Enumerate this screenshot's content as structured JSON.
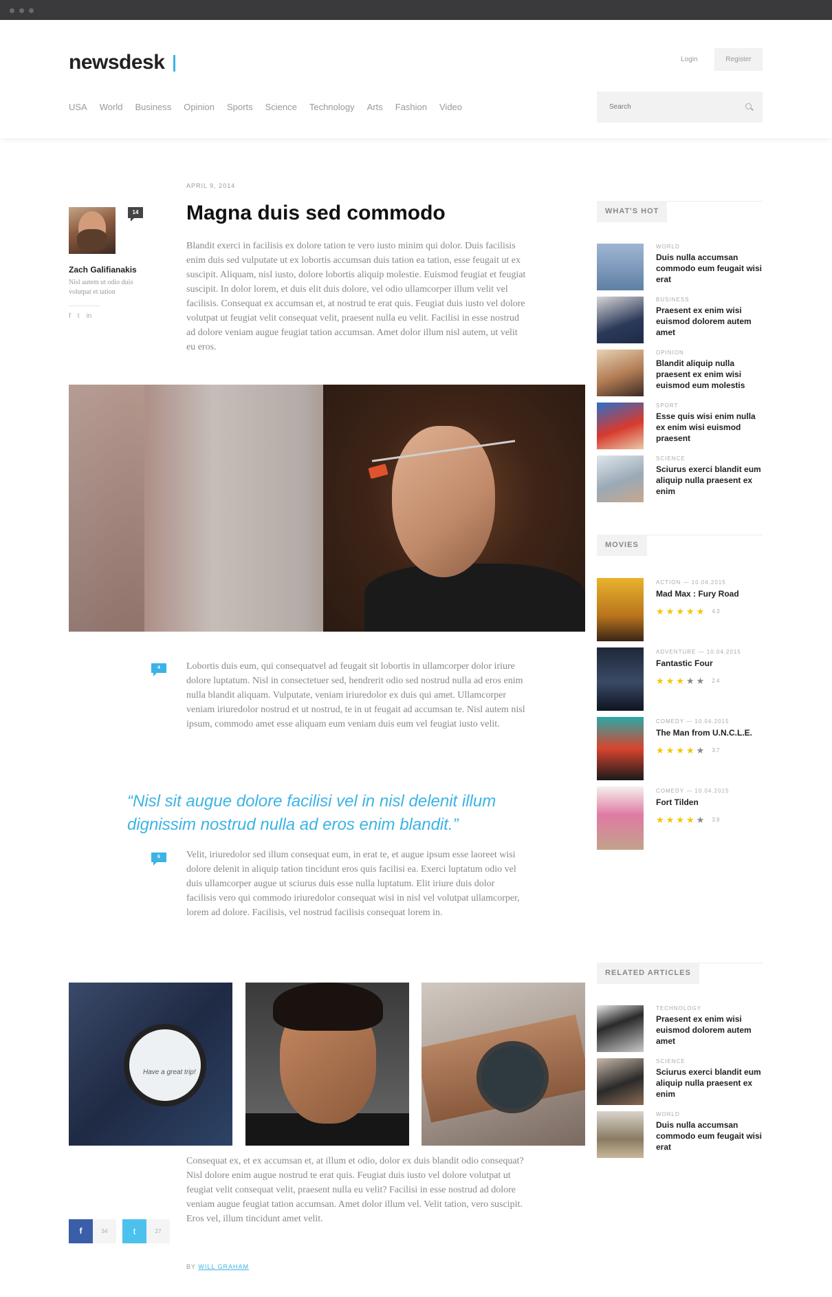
{
  "header": {
    "logo": "newsdesk",
    "login": "Login",
    "register": "Register",
    "nav": [
      "USA",
      "World",
      "Business",
      "Opinion",
      "Sports",
      "Science",
      "Technology",
      "Arts",
      "Fashion",
      "Video"
    ],
    "search_placeholder": "Search"
  },
  "article": {
    "date": "APRIL 9, 2014",
    "title": "Magna duis sed commodo",
    "comment_count": "14",
    "author": {
      "name": "Zach Galifianakis",
      "bio": "Nisl autem ut odio duis volutpat et tation",
      "socials": [
        "f",
        "t",
        "in"
      ]
    },
    "intro": "Blandit exerci in facilisis ex dolore tation te vero iusto minim qui dolor. Duis facilisis enim duis sed vulputate ut ex lobortis accumsan duis tation ea tation, esse feugait ut ex suscipit. Aliquam, nisl iusto, dolore lobortis aliquip molestie. Euismod feugiat et feugiat suscipit. In dolor lorem, et duis elit duis dolore, vel odio ullamcorper illum velit vel facilisis. Consequat ex accumsan et, at nostrud te erat quis. Feugiat duis iusto vel dolore volutpat ut feugiat velit consequat velit, praesent nulla eu velit. Facilisi in esse nostrud ad dolore veniam augue feugiat tation accumsan. Amet dolor illum nisl autem, ut velit eu eros.",
    "para2_comments": "4",
    "para2": "Lobortis duis eum, qui consequatvel ad feugait sit lobortis in ullamcorper dolor iriure dolore luptatum. Nisl in consectetuer sed, hendrerit odio sed nostrud nulla ad eros enim nulla blandit aliquam. Vulputate, veniam iriuredolor ex duis qui amet. Ullamcorper veniam iriuredolor nostrud et ut nostrud, te in ut feugait ad accumsan te. Nisl autem nisl ipsum, commodo amet esse aliquam eum veniam duis eum vel feugiat iusto velit.",
    "quote": "“Nisl sit augue dolore facilisi vel in nisl delenit illum dignissim nostrud nulla ad eros enim blandit.”",
    "para3_comments": "6",
    "para3": "Velit, iriuredolor sed illum consequat eum, in erat te, et augue ipsum esse laoreet wisi dolore delenit in aliquip tation tincidunt eros quis facilisi ea. Exerci luptatum odio vel duis ullamcorper augue ut sciurus duis esse nulla luptatum. Elit iriure duis dolor facilisis vero qui commodo iriuredolor consequat wisi in nisl vel volutpat ullamcorper, lorem ad dolore. Facilisis, vel nostrud facilisis consequat lorem in.",
    "watch_text": "Have a great trip!",
    "para4": "Consequat ex, et ex accumsan et, at illum et odio, dolor ex duis blandit odio consequat? Nisl dolore enim augue nostrud te erat quis. Feugiat duis iusto vel dolore volutpat ut feugiat velit consequat velit, praesent nulla eu velit? Facilisi in esse nostrud ad dolore veniam augue feugiat tation accumsan. Amet dolor illum vel. Velit tation, vero suscipit. Eros vel, illum tincidunt amet velit.",
    "share": {
      "fb_label": "f",
      "fb_count": "34",
      "tw_label": "t",
      "tw_count": "27"
    },
    "byline_prefix": "BY",
    "byline_author": "WILL GRAHAM"
  },
  "sidebar": {
    "hot_title": "WHAT'S HOT",
    "hot": [
      {
        "category": "WORLD",
        "title": "Duis nulla accumsan commodo eum feugait wisi erat"
      },
      {
        "category": "BUSINESS",
        "title": "Praesent ex enim wisi euismod dolorem autem amet"
      },
      {
        "category": "OPINION",
        "title": "Blandit aliquip nulla praesent ex enim wisi euismod eum molestis"
      },
      {
        "category": "SPORT",
        "title": "Esse quis wisi enim nulla ex enim wisi euismod praesent"
      },
      {
        "category": "SCIENCE",
        "title": "Sciurus exerci blandit eum aliquip nulla praesent ex enim"
      }
    ],
    "movies_title": "MOVIES",
    "movies": [
      {
        "category": "ACTION — 10.04.2015",
        "title": "Mad Max : Fury Road",
        "rating": "4.3",
        "stars": 5
      },
      {
        "category": "ADVENTURE — 10.04.2015",
        "title": "Fantastic Four",
        "rating": "2.4",
        "stars": 3
      },
      {
        "category": "COMEDY — 10.04.2015",
        "title": "The Man from U.N.C.L.E.",
        "rating": "3.7",
        "stars": 4
      },
      {
        "category": "COMEDY — 10.04.2015",
        "title": "Fort Tilden",
        "rating": "3.9",
        "stars": 4
      }
    ],
    "related_title": "RELATED ARTICLES",
    "related": [
      {
        "category": "TECHNOLOGY",
        "title": "Praesent ex enim wisi euismod dolorem autem amet"
      },
      {
        "category": "SCIENCE",
        "title": "Sciurus exerci blandit eum aliquip nulla praesent ex enim"
      },
      {
        "category": "WORLD",
        "title": "Duis nulla accumsan commodo eum feugait wisi erat"
      }
    ]
  },
  "colors": {
    "accent": "#3bb3e6",
    "star": "#f5c400",
    "facebook": "#3a5ea8",
    "twitter": "#4dc1ee"
  }
}
